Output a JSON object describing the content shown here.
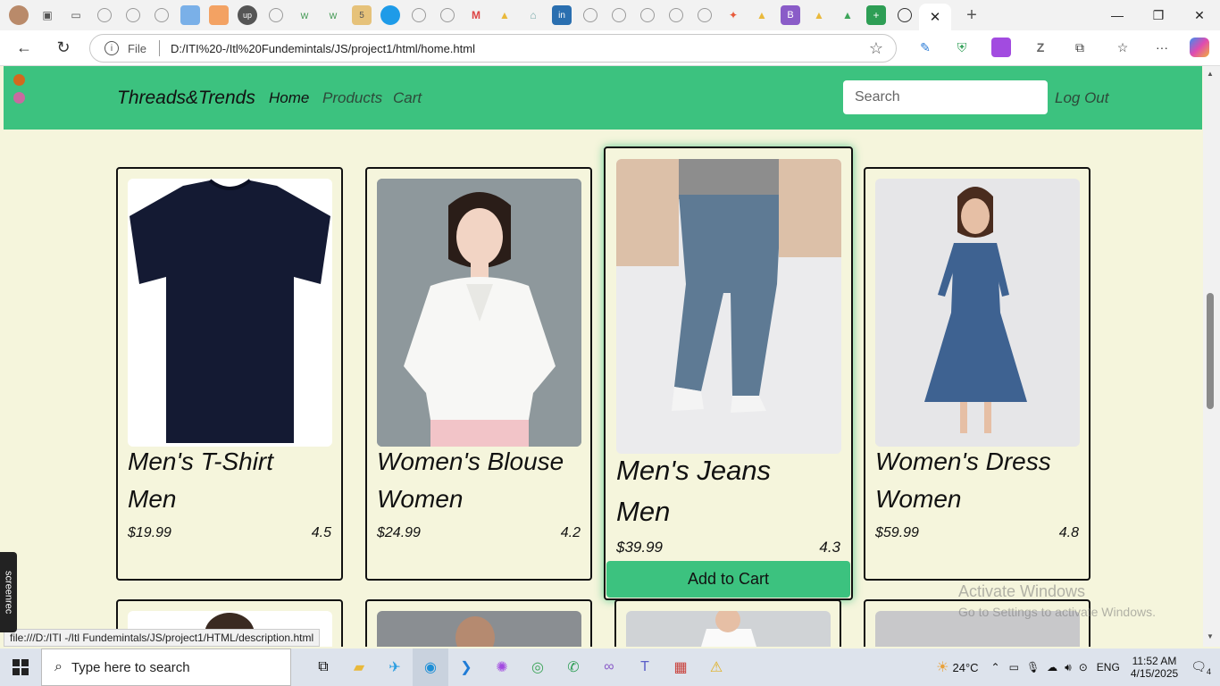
{
  "browser": {
    "active_tab_close": "✕",
    "new_tab": "+",
    "url_prefix": "File",
    "url": "D:/ITI%20-/Itl%20Fundemintals/JS/project1/html/home.html",
    "status_url": "file:///D:/ITI -/Itl Fundemintals/JS/project1/HTML/description.html"
  },
  "site": {
    "brand": "Threads&Trends",
    "nav": [
      "Home",
      "Products",
      "Cart"
    ],
    "search_placeholder": "Search",
    "logout": "Log Out",
    "header_color": "#3cc27f",
    "background_color": "#f5f5dc"
  },
  "products": [
    {
      "title": "Men's T-Shirt",
      "category": "Men",
      "price": "$19.99",
      "rating": "4.5"
    },
    {
      "title": "Women's Blouse",
      "category": "Women",
      "price": "$24.99",
      "rating": "4.2"
    },
    {
      "title": "Men's Jeans",
      "category": "Men",
      "price": "$39.99",
      "rating": "4.3",
      "button": "Add to Cart"
    },
    {
      "title": "Women's Dress",
      "category": "Women",
      "price": "$59.99",
      "rating": "4.8"
    }
  ],
  "overlay": {
    "activate_title": "Activate Windows",
    "activate_sub": "Go to Settings to activate Windows.",
    "screenrec": "screenrec"
  },
  "taskbar": {
    "search_placeholder": "Type here to search",
    "temperature": "24°C",
    "language": "ENG",
    "time": "11:52 AM",
    "date": "4/15/2025",
    "notifications": "4"
  }
}
